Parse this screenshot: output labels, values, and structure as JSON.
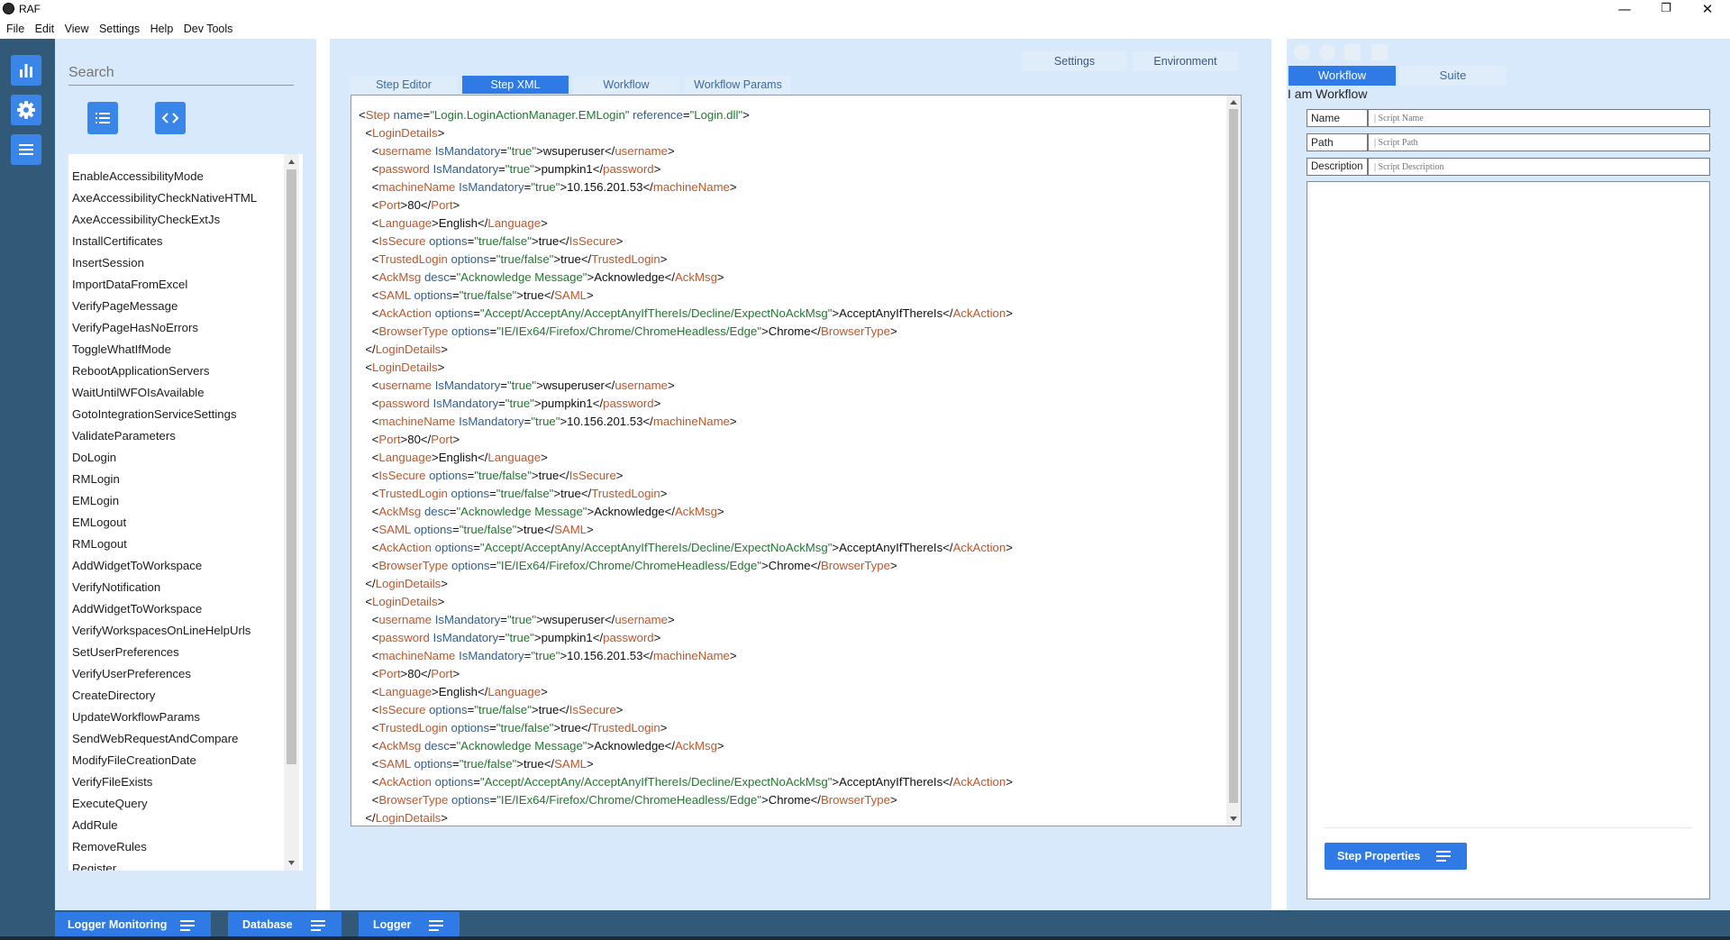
{
  "window": {
    "title": "RAF",
    "minimize": "—",
    "restore": "❐",
    "close": "✕"
  },
  "menu": [
    "File",
    "Edit",
    "View",
    "Settings",
    "Help",
    "Dev Tools"
  ],
  "rail": {
    "icons": [
      "bar-chart-icon",
      "gear-icon",
      "list-icon"
    ]
  },
  "left_panel": {
    "search_placeholder": "Search",
    "steps": [
      "EnableAccessibilityMode",
      "AxeAccessibilityCheckNativeHTML",
      "AxeAccessibilityCheckExtJs",
      "InstallCertificates",
      "InsertSession",
      "ImportDataFromExcel",
      "VerifyPageMessage",
      "VerifyPageHasNoErrors",
      "ToggleWhatIfMode",
      "RebootApplicationServers",
      "WaitUntilWFOIsAvailable",
      "GotoIntegrationServiceSettings",
      "ValidateParameters",
      "DoLogin",
      "RMLogin",
      "EMLogin",
      "EMLogout",
      "RMLogout",
      "AddWidgetToWorkspace",
      "VerifyNotification",
      "AddWidgetToWorkspace",
      "VerifyWorkspacesOnLineHelpUrls",
      "SetUserPreferences",
      "VerifyUserPreferences",
      "CreateDirectory",
      "UpdateWorkflowParams",
      "SendWebRequestAndCompare",
      "ModifyFileCreationDate",
      "VerifyFileExists",
      "ExecuteQuery",
      "AddRule",
      "RemoveRules",
      "Register"
    ]
  },
  "center": {
    "settings_label": "Settings",
    "environment_label": "Environment",
    "tabs": [
      "Step Editor",
      "Step XML",
      "Workflow",
      "Workflow Params"
    ],
    "active_tab": 1,
    "xml": {
      "step_open": {
        "tag": "Step",
        "name_attr": "name",
        "name_val": "\"Login.LoginActionManager.EMLogin\"",
        "ref_attr": "reference",
        "ref_val": "\"Login.dll\""
      },
      "block_tag": "LoginDetails",
      "rows": [
        {
          "tag": "username",
          "attr": "IsMandatory",
          "val": "\"true\"",
          "text": "wsuperuser"
        },
        {
          "tag": "password",
          "attr": "IsMandatory",
          "val": "\"true\"",
          "text": "pumpkin1"
        },
        {
          "tag": "machineName",
          "attr": "IsMandatory",
          "val": "\"true\"",
          "text": "10.156.201.53"
        },
        {
          "tag": "Port",
          "attr": "",
          "val": "",
          "text": "80"
        },
        {
          "tag": "Language",
          "attr": "",
          "val": "",
          "text": "English"
        },
        {
          "tag": "IsSecure",
          "attr": "options",
          "val": "\"true/false\"",
          "text": "true"
        },
        {
          "tag": "TrustedLogin",
          "attr": "options",
          "val": "\"true/false\"",
          "text": "true"
        },
        {
          "tag": "AckMsg",
          "attr": "desc",
          "val": "\"Acknowledge Message\"",
          "text": "Acknowledge"
        },
        {
          "tag": "SAML",
          "attr": "options",
          "val": "\"true/false\"",
          "text": "true"
        },
        {
          "tag": "AckAction",
          "attr": "options",
          "val": "\"Accept/AcceptAny/AcceptAnyIfThereIs/Decline/ExpectNoAckMsg\"",
          "text": "AcceptAnyIfThereIs"
        },
        {
          "tag": "BrowserType",
          "attr": "options",
          "val": "\"IE/IEx64/Firefox/Chrome/ChromeHeadless/Edge\"",
          "text": "Chrome"
        }
      ],
      "block_count": 3
    }
  },
  "right_panel": {
    "tabs": [
      "Workflow",
      "Suite"
    ],
    "heading": "I am Workflow",
    "fields": [
      {
        "label": "Name",
        "placeholder": "| Script Name"
      },
      {
        "label": "Path",
        "placeholder": "| Script Path"
      },
      {
        "label": "Description",
        "placeholder": "| Script Description"
      }
    ],
    "step_properties_label": "Step Properties"
  },
  "bottom": [
    "Logger Monitoring",
    "Database",
    "Logger"
  ]
}
